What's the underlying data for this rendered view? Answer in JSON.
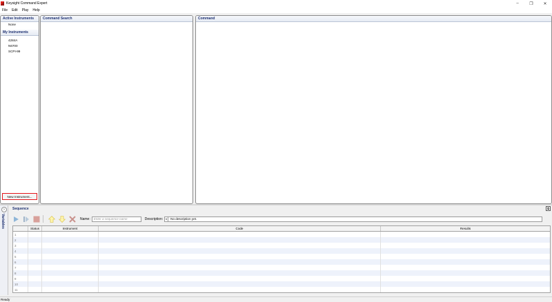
{
  "window": {
    "title": "Keysight Command Expert",
    "minimize": "–",
    "restore": "❐",
    "close": "✕"
  },
  "menu": [
    "File",
    "Edit",
    "Play",
    "Help"
  ],
  "active_instruments": {
    "title": "Active Instruments",
    "items": [
      "None"
    ]
  },
  "my_instruments": {
    "title": "My Instruments",
    "items": [
      "4284A",
      "N6700",
      "SCPI-99"
    ]
  },
  "new_instrument_label": "New Instrument...",
  "command_search": {
    "title": "Command Search"
  },
  "command": {
    "title": "Command"
  },
  "variables_label": "Variables",
  "variables_toggle": "›",
  "sequence": {
    "title": "Sequence",
    "name_label": "Name:",
    "name_placeholder": "Enter a sequence name",
    "description_label": "Description:",
    "description_dropdown": "∨",
    "description_value": "No description yet.",
    "columns": [
      "",
      "Status",
      "Instrument",
      "Code",
      "Results"
    ],
    "row_numbers": [
      "1",
      "2",
      "3",
      "4",
      "5",
      "6",
      "7",
      "8",
      "9",
      "10",
      "11"
    ]
  },
  "status_bar": "Ready",
  "colors": {
    "accent": "#1c2f70",
    "highlight": "#e3151a"
  }
}
